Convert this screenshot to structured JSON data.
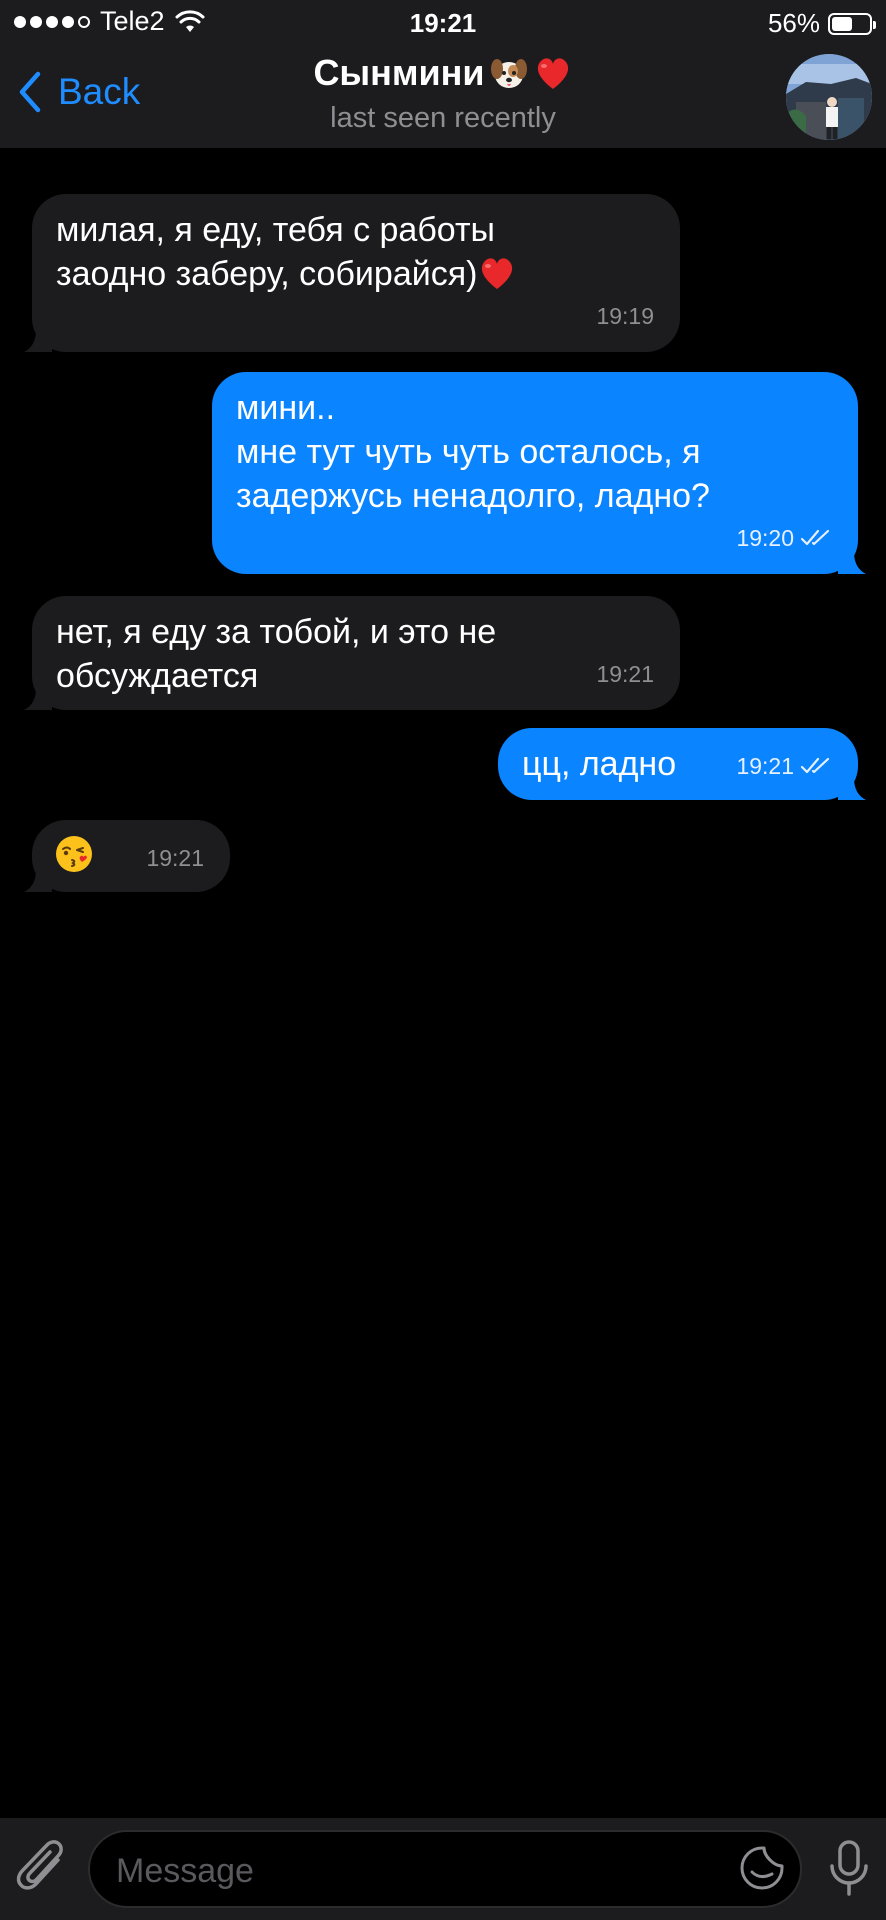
{
  "status_bar": {
    "carrier": "Tele2",
    "time": "19:21",
    "battery_text": "56%",
    "battery_level": 0.56,
    "signal_bars": 4
  },
  "nav": {
    "back_label": "Back",
    "title": "Сынмини",
    "subtitle": "last seen recently"
  },
  "messages": [
    {
      "direction": "incoming",
      "text": "милая, я еду, тебя с работы\nзаодно заберу, собирайся)",
      "trailing_emoji": "heart",
      "time": "19:19"
    },
    {
      "direction": "outgoing",
      "text": "мини..\nмне тут чуть чуть осталось, я\nзадержусь ненадолго, ладно?",
      "time": "19:20",
      "read": true
    },
    {
      "direction": "incoming",
      "text": "нет, я еду за тобой, и это не\nобсуждается",
      "time": "19:21"
    },
    {
      "direction": "outgoing",
      "text": "цц, ладно",
      "time": "19:21",
      "read": true
    },
    {
      "direction": "incoming",
      "text": "",
      "trailing_emoji": "kiss",
      "time": "19:21"
    }
  ],
  "input": {
    "placeholder": "Message"
  },
  "colors": {
    "accent": "#1f8dff",
    "outgoing_bubble": "#0a84ff",
    "incoming_bubble": "#1c1c1e",
    "background": "#000000"
  },
  "icons": [
    "chevron-left-icon",
    "wifi-icon",
    "battery-icon",
    "attach-icon",
    "sticker-icon",
    "mic-icon",
    "double-check-icon"
  ]
}
